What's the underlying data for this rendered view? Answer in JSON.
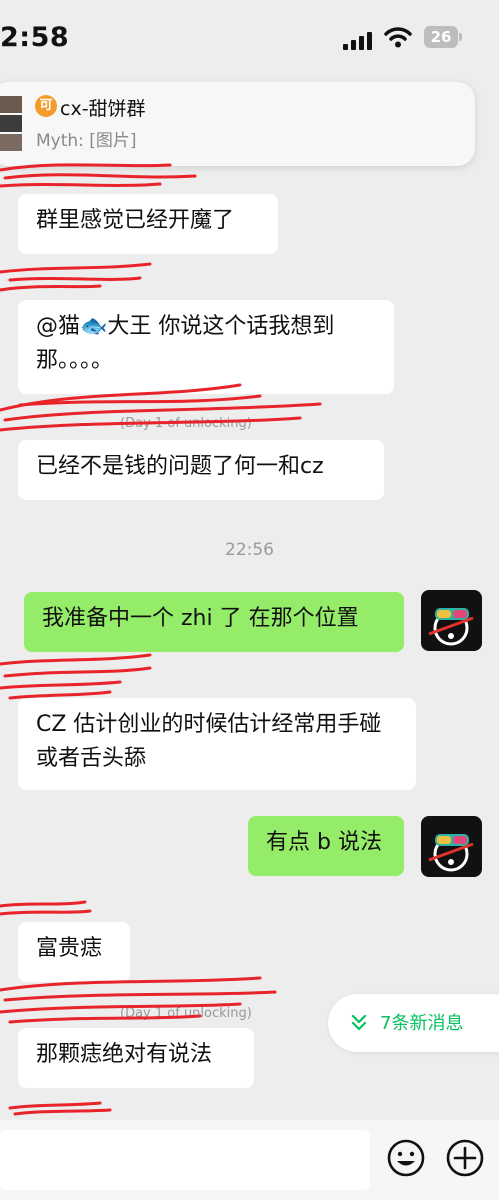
{
  "status_bar": {
    "time": "2:58",
    "battery": "26"
  },
  "banner": {
    "badge": "可",
    "title": "cx-甜饼群",
    "subtitle": "Myth: [图片]"
  },
  "messages": [
    {
      "sender": "",
      "text": "群里感觉已经开魔了"
    },
    {
      "sender": "",
      "text": "@猫🐟大王 你说这个话我想到那。。。。"
    },
    {
      "sender": "(Day 1 of unlocking)",
      "text": "已经不是钱的问题了何一和cz"
    },
    {
      "timestamp": "22:56"
    },
    {
      "me": true,
      "text": "我准备中一个 zhi 了 在那个位置"
    },
    {
      "sender": "",
      "text": "CZ 估计创业的时候估计经常用手碰 或者舌头舔"
    },
    {
      "me": true,
      "text": "有点 b 说法"
    },
    {
      "sender": "",
      "text": "富贵痣"
    },
    {
      "sender": "(Day 1 of unlocking)",
      "text": "那颗痣绝对有说法"
    }
  ],
  "new_messages": {
    "label": "7条新消息"
  },
  "colors": {
    "accent": "#07c160",
    "my_bubble": "#95ec69",
    "background": "#ededed"
  },
  "icons": [
    "signal-icon",
    "wifi-icon",
    "battery-icon",
    "emoji-icon",
    "plus-icon",
    "double-chevron-down-icon"
  ]
}
